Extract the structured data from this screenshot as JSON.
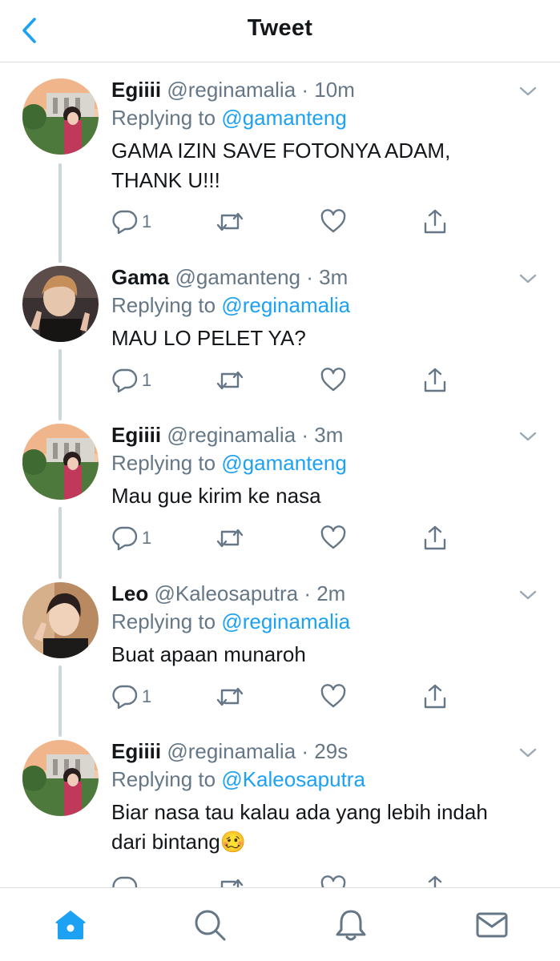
{
  "header": {
    "title": "Tweet"
  },
  "tweets": [
    {
      "name": "Egiiii",
      "handle": "@reginamalia",
      "time": "10m",
      "replying_label": "Replying to",
      "replying_to": "@gamanteng",
      "text": "GAMA IZIN SAVE FOTONYA ADAM, THANK U!!!",
      "reply_count": "1",
      "avatar": "regina"
    },
    {
      "name": "Gama",
      "handle": "@gamanteng",
      "time": "3m",
      "replying_label": "Replying to",
      "replying_to": "@reginamalia",
      "text": "MAU LO PELET YA?",
      "reply_count": "1",
      "avatar": "gama"
    },
    {
      "name": "Egiiii",
      "handle": "@reginamalia",
      "time": "3m",
      "replying_label": "Replying to",
      "replying_to": "@gamanteng",
      "text": "Mau gue kirim ke nasa",
      "reply_count": "1",
      "avatar": "regina"
    },
    {
      "name": "Leo",
      "handle": "@Kaleosaputra",
      "time": "2m",
      "replying_label": "Replying to",
      "replying_to": "@reginamalia",
      "text": "Buat apaan munaroh",
      "reply_count": "1",
      "avatar": "leo"
    },
    {
      "name": "Egiiii",
      "handle": "@reginamalia",
      "time": "29s",
      "replying_label": "Replying to",
      "replying_to": "@Kaleosaputra",
      "text": "Biar nasa tau kalau ada yang lebih indah dari bintang",
      "emoji": "🥴",
      "reply_count": "",
      "avatar": "regina"
    }
  ],
  "tab_bar": {
    "items": [
      "home-icon",
      "search-icon",
      "notifications-icon",
      "messages-icon"
    ],
    "active": "home-icon"
  },
  "colors": {
    "accent": "#1da1f2",
    "secondary_text": "#657786",
    "thread_line": "#ccd6dd"
  }
}
